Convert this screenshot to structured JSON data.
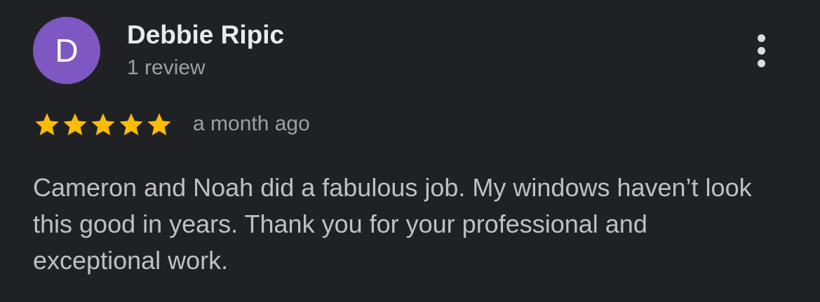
{
  "review": {
    "avatar_letter": "D",
    "avatar_color": "#7e57c2",
    "reviewer_name": "Debbie Ripic",
    "review_count": "1 review",
    "rating": 5,
    "rating_max": 5,
    "star_color": "#fbbc04",
    "time": "a month ago",
    "text": "Cameron and Noah did a fabulous job. My windows haven’t look this good in years. Thank you for your professional and exceptional work.",
    "more_icon": "more-vert-icon"
  }
}
